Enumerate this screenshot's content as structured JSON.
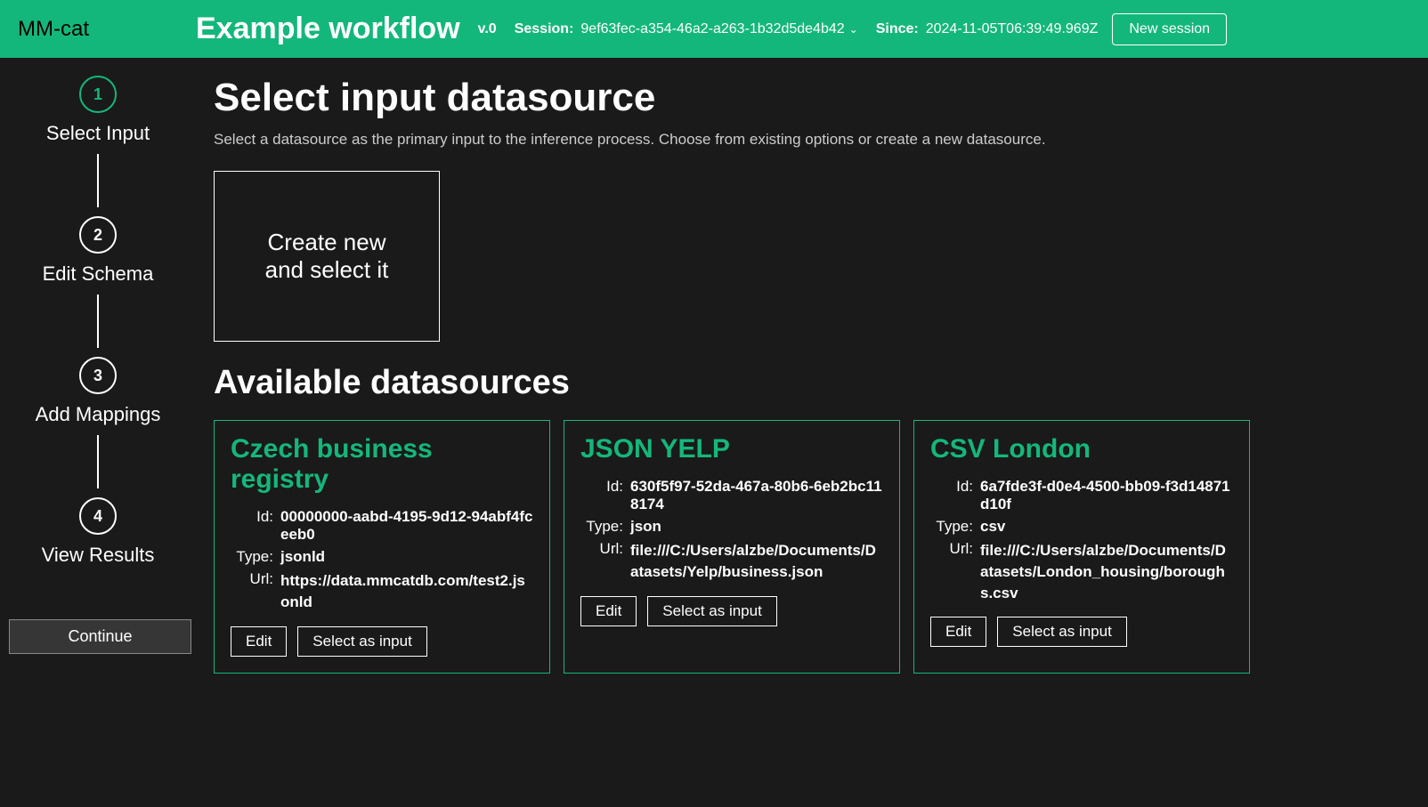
{
  "header": {
    "logo": "MM-cat",
    "workflow_title": "Example workflow",
    "version": "v.0",
    "session_label": "Session:",
    "session_value": "9ef63fec-a354-46a2-a263-1b32d5de4b42",
    "since_label": "Since:",
    "since_value": "2024-11-05T06:39:49.969Z",
    "new_session_button": "New session"
  },
  "sidebar": {
    "steps": [
      {
        "num": "1",
        "label": "Select Input",
        "active": true
      },
      {
        "num": "2",
        "label": "Edit Schema",
        "active": false
      },
      {
        "num": "3",
        "label": "Add Mappings",
        "active": false
      },
      {
        "num": "4",
        "label": "View Results",
        "active": false
      }
    ],
    "continue_button": "Continue"
  },
  "main": {
    "page_title": "Select input datasource",
    "page_subtitle": "Select a datasource as the primary input to the inference process. Choose from existing options or create a new datasource.",
    "create_new_line1": "Create new",
    "create_new_line2": "and select it",
    "section_title": "Available datasources",
    "id_label": "Id:",
    "type_label": "Type:",
    "url_label": "Url:",
    "edit_button": "Edit",
    "select_button": "Select as input",
    "datasources": [
      {
        "title": "Czech business registry",
        "id": "00000000-aabd-4195-9d12-94abf4fceeb0",
        "type": "jsonld",
        "url": "https://data.mmcatdb.com/test2.jsonld"
      },
      {
        "title": "JSON YELP",
        "id": "630f5f97-52da-467a-80b6-6eb2bc118174",
        "type": "json",
        "url": "file:///C:/Users/alzbe/Documents/Datasets/Yelp/business.json"
      },
      {
        "title": "CSV London",
        "id": "6a7fde3f-d0e4-4500-bb09-f3d14871d10f",
        "type": "csv",
        "url": "file:///C:/Users/alzbe/Documents/Datasets/London_housing/boroughs.csv"
      }
    ]
  }
}
